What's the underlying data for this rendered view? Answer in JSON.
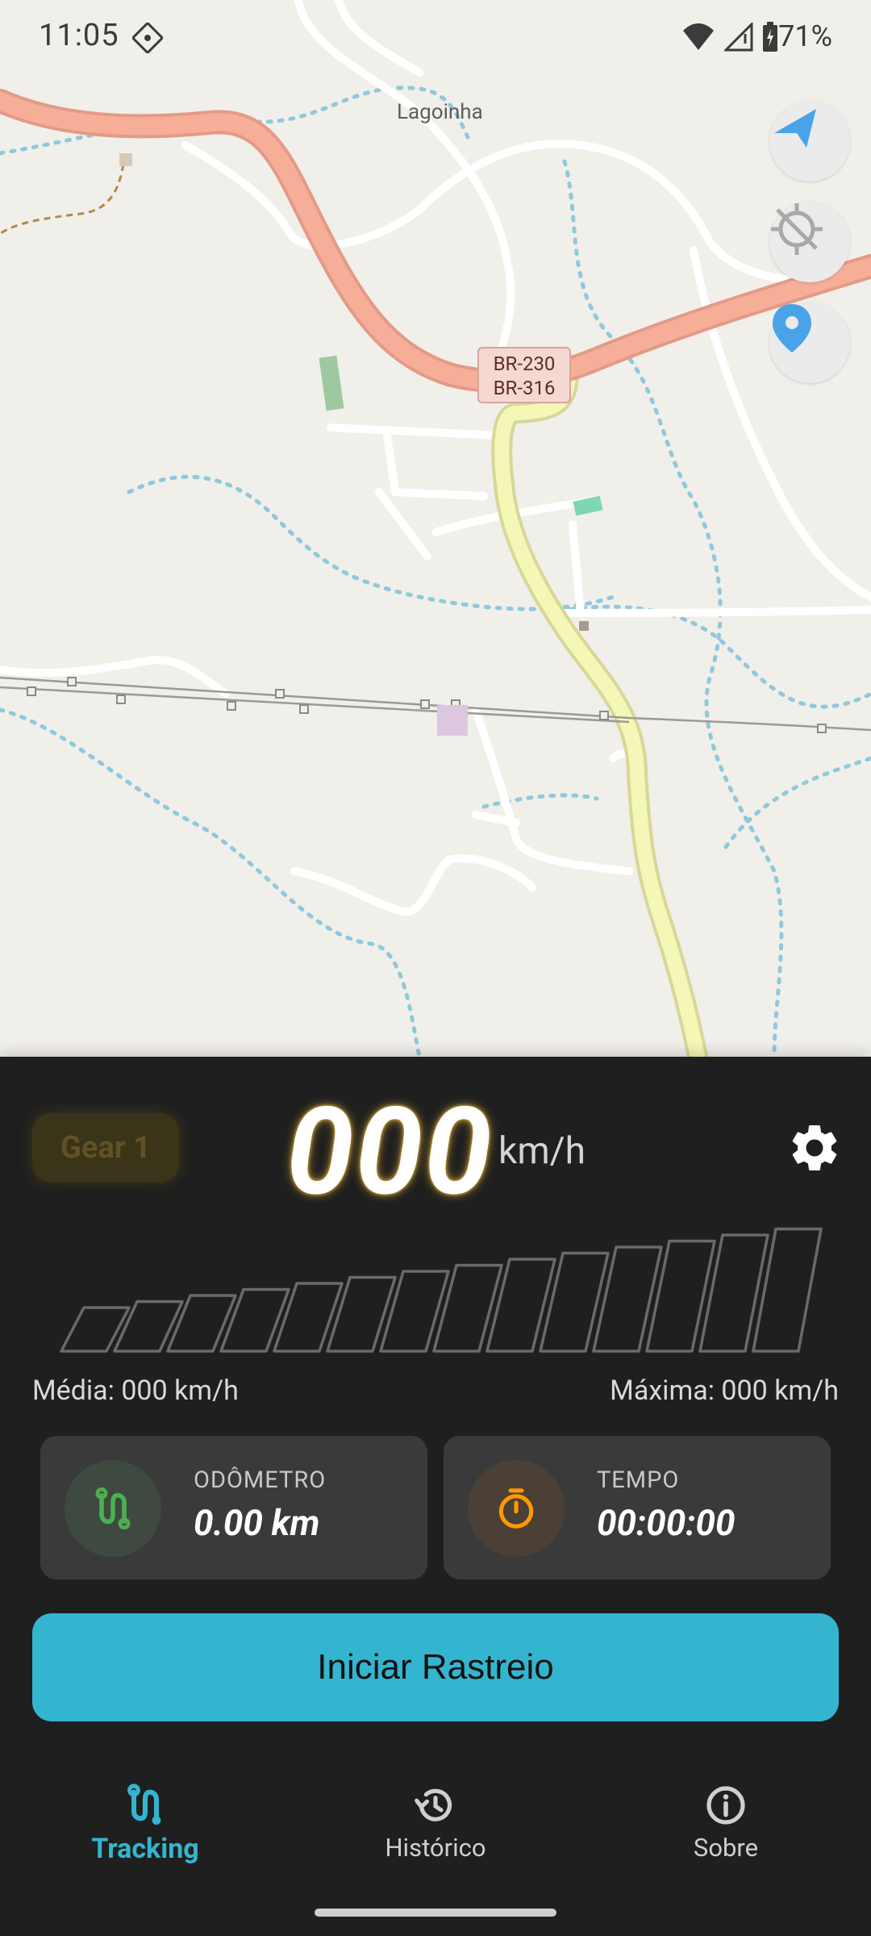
{
  "status_bar": {
    "time": "11:05",
    "battery": "71%"
  },
  "map": {
    "place_label": "Lagoinha",
    "road_shield": [
      "BR-230",
      "BR-316"
    ],
    "buttons": {
      "navigate_icon": "navigation-arrow-icon",
      "gps_icon": "gps-off-icon",
      "location_icon": "location-pin-icon"
    }
  },
  "speedometer": {
    "gear_label": "Gear 1",
    "speed": "000",
    "unit": "km/h",
    "average_label": "Média: 000 km/h",
    "max_label": "Máxima: 000 km/h",
    "gauge_segments": 14,
    "gauge_level": 0
  },
  "cards": {
    "odometer": {
      "title": "ODÔMETRO",
      "value": "0.00 km",
      "icon": "route-icon"
    },
    "time": {
      "title": "TEMPO",
      "value": "00:00:00",
      "icon": "timer-icon"
    }
  },
  "actions": {
    "start_tracking": "Iniciar Rastreio"
  },
  "bottom_nav": {
    "items": [
      {
        "label": "Tracking",
        "icon": "route-icon",
        "active": true
      },
      {
        "label": "Histórico",
        "icon": "history-icon",
        "active": false
      },
      {
        "label": "Sobre",
        "icon": "info-icon",
        "active": false
      }
    ]
  },
  "colors": {
    "accent": "#33b5cf",
    "panel_bg": "#1f1f1f",
    "card_bg": "#3a3a3a",
    "gear_text": "#605226",
    "odometer_icon": "#4caf50",
    "timer_icon": "#ff9800",
    "map_button_blue": "#4aa3e8"
  }
}
